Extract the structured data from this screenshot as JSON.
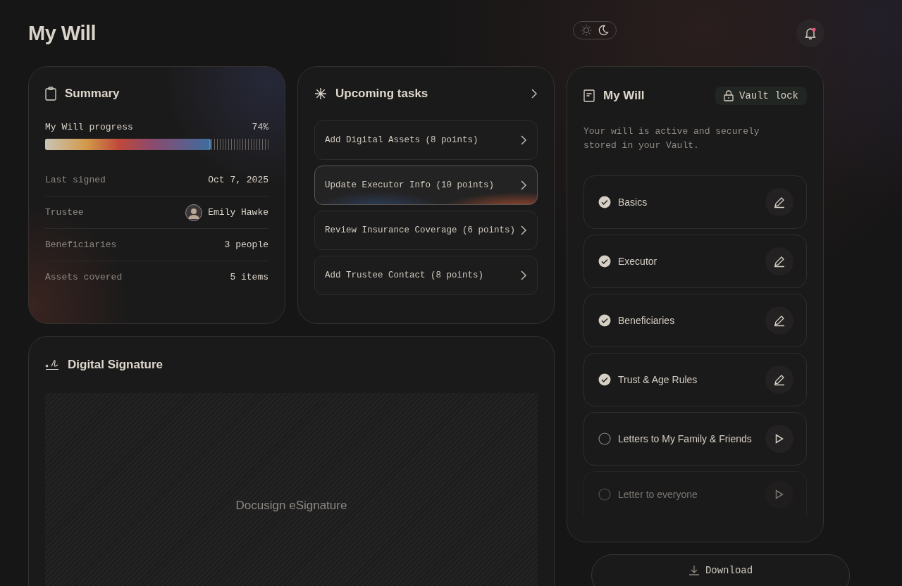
{
  "page": {
    "title": "My Will"
  },
  "theme_toggle": [
    {
      "kind": "sun",
      "selected": false
    },
    {
      "kind": "moon",
      "selected": true
    }
  ],
  "notifications": {
    "unread": true
  },
  "summary": {
    "title": "Summary",
    "progress_label": "My Will progress",
    "progress_value": "74%",
    "level": 0.74,
    "rows": [
      {
        "label": "Last signed",
        "value": "Oct 7, 2025"
      },
      {
        "label": "Trustee",
        "value": "Emily Hawke",
        "kind": "person"
      },
      {
        "label": "Beneficiaries",
        "value": "3 people"
      },
      {
        "label": "Assets covered",
        "value": "5 items"
      }
    ]
  },
  "tasks": {
    "title": "Upcoming tasks",
    "items": [
      {
        "label": "Add Digital Assets (8 points)",
        "selected": false
      },
      {
        "label": "Update Executor Info (10 points)",
        "selected": true
      },
      {
        "label": "Review Insurance Coverage (6 points)",
        "selected": false
      },
      {
        "label": "Add Trustee Contact (8 points)",
        "selected": false
      }
    ]
  },
  "will": {
    "title": "My Will",
    "lock_label": "Vault lock",
    "description": "Your will is active and securely stored in your Vault.",
    "sections": [
      {
        "label": "Basics",
        "done": true,
        "kind": "edit",
        "disabled": false
      },
      {
        "label": "Executor",
        "done": true,
        "kind": "edit",
        "disabled": false
      },
      {
        "label": "Beneficiaries",
        "done": true,
        "kind": "edit",
        "disabled": false
      },
      {
        "label": "Trust & Age Rules",
        "done": true,
        "kind": "edit",
        "disabled": false
      },
      {
        "label": "Letters to My Family & Friends",
        "done": false,
        "kind": "play",
        "disabled": false
      },
      {
        "label": "Letter to everyone",
        "done": false,
        "kind": "play",
        "disabled": true
      }
    ]
  },
  "download": {
    "label": "Download"
  },
  "signature": {
    "title": "Digital Signature",
    "placeholder": "Docusign eSignature"
  }
}
